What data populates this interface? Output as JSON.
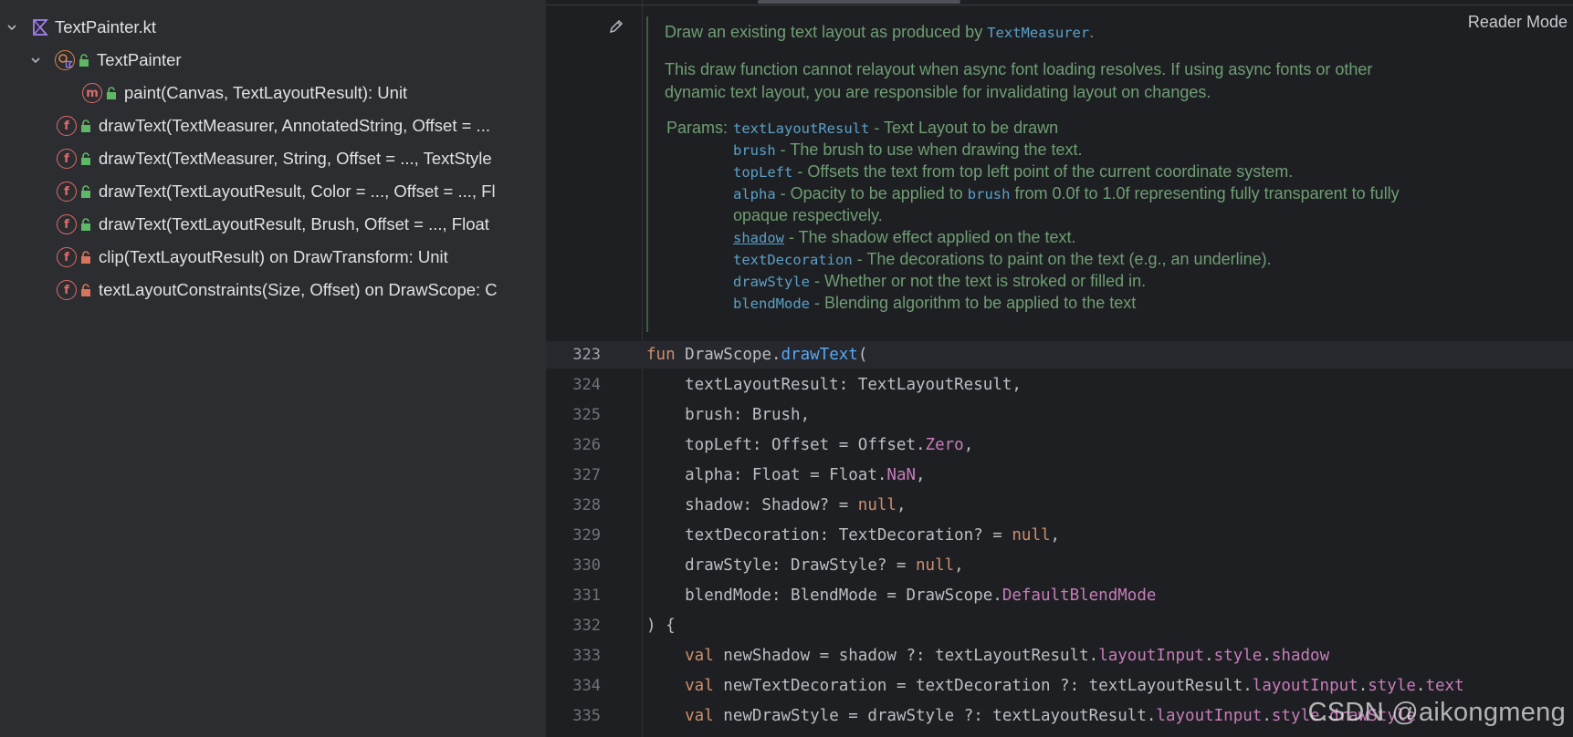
{
  "structure": {
    "file": "TextPainter.kt",
    "class_name": "TextPainter",
    "method": "paint(Canvas, TextLayoutResult): Unit",
    "method_badge": "m",
    "function_badge": "f",
    "functions": [
      {
        "label": "drawText(TextMeasurer, AnnotatedString, Offset = ...",
        "visibility": "public"
      },
      {
        "label": "drawText(TextMeasurer, String, Offset = ..., TextStyle",
        "visibility": "public"
      },
      {
        "label": "drawText(TextLayoutResult, Color = ..., Offset = ..., Fl",
        "visibility": "public"
      },
      {
        "label": "drawText(TextLayoutResult, Brush, Offset = ..., Float",
        "visibility": "public"
      },
      {
        "label": "clip(TextLayoutResult) on DrawTransform: Unit",
        "visibility": "private"
      },
      {
        "label": "textLayoutConstraints(Size, Offset) on DrawScope: C",
        "visibility": "private"
      }
    ]
  },
  "editor": {
    "reader_mode": "Reader Mode",
    "doc": {
      "summary_prefix": "Draw an existing text layout as produced by ",
      "summary_link": "TextMeasurer",
      "summary_suffix": ".",
      "note_line1": "This draw function cannot relayout when async font loading resolves. If using async fonts or other",
      "note_line2": "dynamic text layout, you are responsible for invalidating layout on changes.",
      "params_label": "Params:",
      "params": [
        {
          "name": "textLayoutResult",
          "desc": " - Text Layout to be drawn"
        },
        {
          "name": "brush",
          "desc": " - The brush to use when drawing the text."
        },
        {
          "name": "topLeft",
          "desc": " - Offsets the text from top left point of the current coordinate system."
        },
        {
          "name": "alpha",
          "desc": " - Opacity to be applied to ",
          "ref": "brush",
          "desc2": " from 0.0f to 1.0f representing fully transparent to fully"
        },
        {
          "name": "",
          "desc": "opaque respectively."
        },
        {
          "name": "shadow",
          "desc": " - The shadow effect applied on the text.",
          "underline": true
        },
        {
          "name": "textDecoration",
          "desc": " - The decorations to paint on the text (e.g., an underline)."
        },
        {
          "name": "drawStyle",
          "desc": " - Whether or not the text is stroked or filled in."
        },
        {
          "name": "blendMode",
          "desc": " - Blending algorithm to be applied to the text"
        }
      ]
    },
    "lines": [
      {
        "num": "323",
        "current": true,
        "tokens": [
          [
            "kw",
            "fun "
          ],
          [
            "dim",
            "DrawScope."
          ],
          [
            "fn",
            "drawText"
          ],
          [
            "dim",
            "("
          ]
        ]
      },
      {
        "num": "324",
        "tokens": [
          [
            "dim",
            "    textLayoutResult: TextLayoutResult,"
          ]
        ]
      },
      {
        "num": "325",
        "tokens": [
          [
            "dim",
            "    brush: Brush,"
          ]
        ]
      },
      {
        "num": "326",
        "tokens": [
          [
            "dim",
            "    topLeft: Offset = Offset."
          ],
          [
            "prop",
            "Zero"
          ],
          [
            "dim",
            ","
          ]
        ]
      },
      {
        "num": "327",
        "tokens": [
          [
            "dim",
            "    alpha: Float = Float."
          ],
          [
            "prop",
            "NaN"
          ],
          [
            "dim",
            ","
          ]
        ]
      },
      {
        "num": "328",
        "tokens": [
          [
            "dim",
            "    shadow: Shadow? = "
          ],
          [
            "kw",
            "null"
          ],
          [
            "dim",
            ","
          ]
        ]
      },
      {
        "num": "329",
        "tokens": [
          [
            "dim",
            "    textDecoration: TextDecoration? = "
          ],
          [
            "kw",
            "null"
          ],
          [
            "dim",
            ","
          ]
        ]
      },
      {
        "num": "330",
        "tokens": [
          [
            "dim",
            "    drawStyle: DrawStyle? = "
          ],
          [
            "kw",
            "null"
          ],
          [
            "dim",
            ","
          ]
        ]
      },
      {
        "num": "331",
        "tokens": [
          [
            "dim",
            "    blendMode: BlendMode = DrawScope."
          ],
          [
            "prop",
            "DefaultBlendMode"
          ]
        ]
      },
      {
        "num": "332",
        "tokens": [
          [
            "dim",
            ") {"
          ]
        ]
      },
      {
        "num": "333",
        "tokens": [
          [
            "kw",
            "    val "
          ],
          [
            "dim",
            "newShadow = shadow ?: textLayoutResult."
          ],
          [
            "prop",
            "layoutInput"
          ],
          [
            "dim",
            "."
          ],
          [
            "prop",
            "style"
          ],
          [
            "dim",
            "."
          ],
          [
            "prop",
            "shadow"
          ]
        ]
      },
      {
        "num": "334",
        "tokens": [
          [
            "kw",
            "    val "
          ],
          [
            "dim",
            "newTextDecoration = textDecoration ?: textLayoutResult."
          ],
          [
            "prop",
            "layoutInput"
          ],
          [
            "dim",
            "."
          ],
          [
            "prop",
            "style"
          ],
          [
            "dim",
            "."
          ],
          [
            "prop",
            "text"
          ]
        ]
      },
      {
        "num": "335",
        "tokens": [
          [
            "kw",
            "    val "
          ],
          [
            "dim",
            "newDrawStyle = drawStyle ?: textLayoutResult."
          ],
          [
            "prop",
            "layoutInput"
          ],
          [
            "dim",
            "."
          ],
          [
            "prop",
            "style"
          ],
          [
            "dim",
            "."
          ],
          [
            "prop",
            "drawStyle"
          ]
        ]
      }
    ]
  },
  "watermark": "CSDN @aikongmeng",
  "colors": {
    "keyword": "#cf8e6d",
    "function": "#56a8f5",
    "property": "#c77dbb",
    "doc_text": "#6f9e74",
    "doc_code": "#5aa0c8"
  }
}
